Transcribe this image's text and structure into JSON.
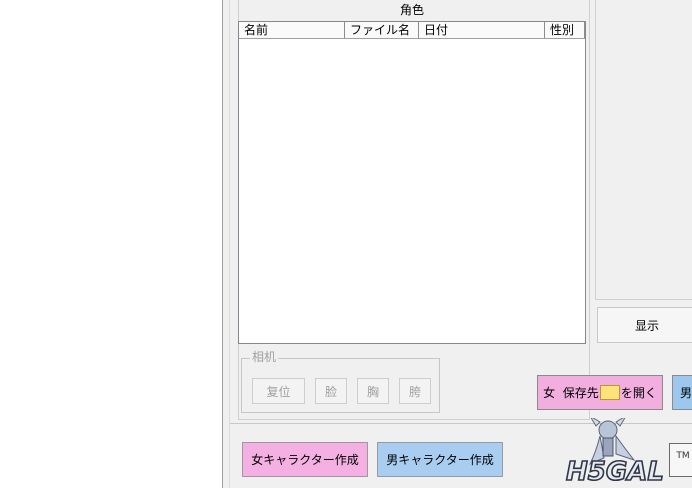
{
  "list": {
    "title": "角色",
    "columns": [
      "名前",
      "ファイル名",
      "日付",
      "性別"
    ]
  },
  "preview": {
    "show_button": "显示"
  },
  "camera": {
    "legend": "相机",
    "buttons": [
      "复位",
      "脸",
      "胸",
      "胯"
    ]
  },
  "save": {
    "female_prefix": "女  保存先",
    "female_suffix": "を開く",
    "male_prefix": "男"
  },
  "create": {
    "female": "女キャラクター作成",
    "male": "男キャラクター作成"
  },
  "logo": {
    "text": "H5GAL",
    "tm": "TM"
  },
  "colors": {
    "female_pink": "#f3aee0",
    "male_blue": "#9cc8f0",
    "panel_bg": "#f0f0f0"
  }
}
